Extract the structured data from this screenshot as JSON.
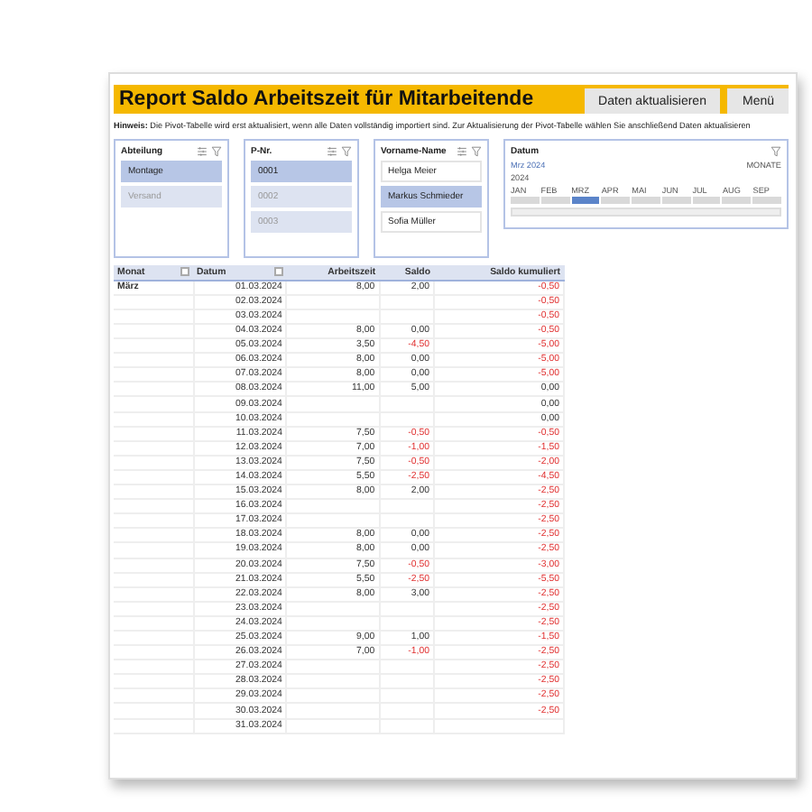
{
  "header": {
    "title": "Report Saldo Arbeitszeit für Mitarbeitende",
    "buttons": [
      "Daten aktualisieren",
      "Menü"
    ],
    "hint": "**Hinweis:** Die Pivot-Tabelle wird erst aktualisiert, wenn alle Daten vollständig importiert sind. Zur Aktualisierung der Pivot-Tabelle wählen Sie anschließend Daten aktualisieren"
  },
  "slicers": [
    {
      "title": "Abteilung",
      "items": [
        {
          "label": "Montage",
          "selected": true,
          "disabled": false
        },
        {
          "label": "Versand",
          "selected": false,
          "disabled": true
        }
      ]
    },
    {
      "title": "P-Nr.",
      "items": [
        {
          "label": "0001",
          "selected": true,
          "disabled": false
        },
        {
          "label": "0002",
          "selected": false,
          "disabled": true
        },
        {
          "label": "0003",
          "selected": false,
          "disabled": true
        }
      ]
    },
    {
      "title": "Vorname-Name",
      "items": [
        {
          "label": "Helga Meier",
          "selected": false,
          "disabled": false
        },
        {
          "label": "Markus Schmieder",
          "selected": true,
          "disabled": false
        },
        {
          "label": "Sofia Müller",
          "selected": false,
          "disabled": false
        }
      ]
    }
  ],
  "timeline": {
    "title": "Datum",
    "selection": "Mrz 2024",
    "level": "MONATE",
    "year": "2024",
    "months": [
      {
        "label": "JAN",
        "selected": false
      },
      {
        "label": "FEB",
        "selected": false
      },
      {
        "label": "MRZ",
        "selected": true
      },
      {
        "label": "APR",
        "selected": false
      },
      {
        "label": "MAI",
        "selected": false
      },
      {
        "label": "JUN",
        "selected": false
      },
      {
        "label": "JUL",
        "selected": false
      },
      {
        "label": "AUG",
        "selected": false
      },
      {
        "label": "SEP",
        "selected": false
      }
    ]
  },
  "table": {
    "columns": [
      "Monat",
      "Datum",
      "Arbeitszeit",
      "Saldo",
      "Saldo kumuliert"
    ],
    "group": "März",
    "rows": [
      {
        "date": "01.03.2024",
        "hours": "8,00",
        "saldo": "2,00",
        "saldo_negative": false,
        "cumulative": "-0,50",
        "cumulative_negative": true
      },
      {
        "date": "02.03.2024",
        "cumulative": "-0,50",
        "cumulative_negative": true
      },
      {
        "date": "03.03.2024",
        "cumulative": "-0,50",
        "cumulative_negative": true
      },
      {
        "date": "04.03.2024",
        "hours": "8,00",
        "saldo": "0,00",
        "saldo_negative": false,
        "cumulative": "-0,50",
        "cumulative_negative": true
      },
      {
        "date": "05.03.2024",
        "hours": "3,50",
        "saldo": "-4,50",
        "saldo_negative": true,
        "cumulative": "-5,00",
        "cumulative_negative": true
      },
      {
        "date": "06.03.2024",
        "hours": "8,00",
        "saldo": "0,00",
        "saldo_negative": false,
        "cumulative": "-5,00",
        "cumulative_negative": true
      },
      {
        "date": "07.03.2024",
        "hours": "8,00",
        "saldo": "0,00",
        "saldo_negative": false,
        "cumulative": "-5,00",
        "cumulative_negative": true
      },
      {
        "date": "08.03.2024",
        "hours": "11,00",
        "saldo": "5,00",
        "saldo_negative": false,
        "cumulative": "0,00",
        "cumulative_negative": false
      },
      {
        "date": "09.03.2024",
        "cumulative": "0,00",
        "cumulative_negative": false
      },
      {
        "date": "10.03.2024",
        "cumulative": "0,00",
        "cumulative_negative": false
      },
      {
        "date": "11.03.2024",
        "hours": "7,50",
        "saldo": "-0,50",
        "saldo_negative": true,
        "cumulative": "-0,50",
        "cumulative_negative": true
      },
      {
        "date": "12.03.2024",
        "hours": "7,00",
        "saldo": "-1,00",
        "saldo_negative": true,
        "cumulative": "-1,50",
        "cumulative_negative": true
      },
      {
        "date": "13.03.2024",
        "hours": "7,50",
        "saldo": "-0,50",
        "saldo_negative": true,
        "cumulative": "-2,00",
        "cumulative_negative": true
      },
      {
        "date": "14.03.2024",
        "hours": "5,50",
        "saldo": "-2,50",
        "saldo_negative": true,
        "cumulative": "-4,50",
        "cumulative_negative": true
      },
      {
        "date": "15.03.2024",
        "hours": "8,00",
        "saldo": "2,00",
        "saldo_negative": false,
        "cumulative": "-2,50",
        "cumulative_negative": true
      },
      {
        "date": "16.03.2024",
        "cumulative": "-2,50",
        "cumulative_negative": true
      },
      {
        "date": "17.03.2024",
        "cumulative": "-2,50",
        "cumulative_negative": true
      },
      {
        "date": "18.03.2024",
        "hours": "8,00",
        "saldo": "0,00",
        "saldo_negative": false,
        "cumulative": "-2,50",
        "cumulative_negative": true
      },
      {
        "date": "19.03.2024",
        "hours": "8,00",
        "saldo": "0,00",
        "saldo_negative": false,
        "cumulative": "-2,50",
        "cumulative_negative": true
      },
      {
        "date": "20.03.2024",
        "hours": "7,50",
        "saldo": "-0,50",
        "saldo_negative": true,
        "cumulative": "-3,00",
        "cumulative_negative": true
      },
      {
        "date": "21.03.2024",
        "hours": "5,50",
        "saldo": "-2,50",
        "saldo_negative": true,
        "cumulative": "-5,50",
        "cumulative_negative": true
      },
      {
        "date": "22.03.2024",
        "hours": "8,00",
        "saldo": "3,00",
        "saldo_negative": false,
        "cumulative": "-2,50",
        "cumulative_negative": true
      },
      {
        "date": "23.03.2024",
        "cumulative": "-2,50",
        "cumulative_negative": true
      },
      {
        "date": "24.03.2024",
        "cumulative": "-2,50",
        "cumulative_negative": true
      },
      {
        "date": "25.03.2024",
        "hours": "9,00",
        "saldo": "1,00",
        "saldo_negative": false,
        "cumulative": "-1,50",
        "cumulative_negative": true
      },
      {
        "date": "26.03.2024",
        "hours": "7,00",
        "saldo": "-1,00",
        "saldo_negative": true,
        "cumulative": "-2,50",
        "cumulative_negative": true
      },
      {
        "date": "27.03.2024",
        "cumulative": "-2,50",
        "cumulative_negative": true
      },
      {
        "date": "28.03.2024",
        "cumulative": "-2,50",
        "cumulative_negative": true
      },
      {
        "date": "29.03.2024",
        "cumulative": "-2,50",
        "cumulative_negative": true
      },
      {
        "date": "30.03.2024",
        "cumulative": "-2,50",
        "cumulative_negative": true
      },
      {
        "date": "31.03.2024"
      }
    ]
  }
}
